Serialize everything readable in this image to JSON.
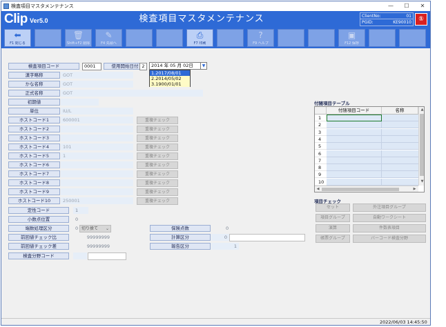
{
  "window": {
    "title": "検査項目マスタメンテナンス",
    "controls": {
      "minimize": "—",
      "maximize": "☐",
      "close": "✕"
    }
  },
  "header": {
    "logo": "Clip",
    "version": "Ver5.0",
    "title": "検査項目マスタメンテナンス",
    "client_label": "ClientNo:",
    "client_value": "01",
    "pgid_label": "PGID:",
    "pgid_value": "KE90010",
    "badge": "①"
  },
  "toolbar": [
    {
      "label": "F1 閉じる",
      "icon": "back-arrow-icon",
      "glyph": "⬅",
      "state": "active"
    },
    {
      "label": "",
      "icon": "",
      "glyph": "",
      "state": "disabled"
    },
    {
      "label": "Shift+F2 削除",
      "icon": "trash-icon",
      "glyph": "🗑",
      "state": "disabled"
    },
    {
      "label": "F4 先頭へ",
      "icon": "pencil-icon",
      "glyph": "✎",
      "state": "disabled"
    },
    {
      "label": "",
      "icon": "",
      "glyph": "",
      "state": "disabled"
    },
    {
      "label": "",
      "icon": "",
      "glyph": "",
      "state": "disabled"
    },
    {
      "label": "F7 印刷",
      "icon": "printer-icon",
      "glyph": "⎙",
      "state": "active"
    },
    {
      "label": "",
      "icon": "",
      "glyph": "",
      "state": "disabled"
    },
    {
      "label": "F9 ヘルプ",
      "icon": "help-icon",
      "glyph": "?",
      "state": "disabled"
    },
    {
      "label": "",
      "icon": "",
      "glyph": "",
      "state": "disabled"
    },
    {
      "label": "",
      "icon": "",
      "glyph": "",
      "state": "disabled"
    },
    {
      "label": "F12 保存",
      "icon": "save-icon",
      "glyph": "▣",
      "state": "disabled"
    },
    {
      "label": "",
      "icon": "",
      "glyph": "",
      "state": "disabled"
    },
    {
      "label": "",
      "icon": "",
      "glyph": "",
      "state": "disabled"
    }
  ],
  "form": {
    "code_label": "検査項目コード",
    "code_value": "0001",
    "start_date_label": "使用開始日付",
    "start_seq": "2",
    "start_date_value": "2014 年 05 月 02日",
    "date_options": [
      "1.2017/08/01",
      "2.2014/05/02",
      "3.1900/01/01"
    ],
    "kanji_label": "漢字略称",
    "kanji_value": "GOT",
    "kana_label": "かな名称",
    "kana_value": "GOT",
    "formal_label": "正式名称",
    "formal_value": "GOT",
    "initial_label": "初期値",
    "initial_value": "",
    "unit_label": "単位",
    "unit_value": "IU/L",
    "hosts": [
      {
        "label": "ホストコード1",
        "value": "600001"
      },
      {
        "label": "ホストコード2",
        "value": ""
      },
      {
        "label": "ホストコード3",
        "value": ""
      },
      {
        "label": "ホストコード4",
        "value": "101"
      },
      {
        "label": "ホストコード5",
        "value": "1"
      },
      {
        "label": "ホストコード6",
        "value": ""
      },
      {
        "label": "ホストコード7",
        "value": ""
      },
      {
        "label": "ホストコード8",
        "value": ""
      },
      {
        "label": "ホストコード9",
        "value": ""
      },
      {
        "label": "ホストコード10",
        "value": "250001"
      }
    ],
    "dup_check_label": "重複チェック",
    "fixed_code_label": "定性コード",
    "fixed_code_value": "1",
    "decimal_label": "小数点位置",
    "decimal_value": "0",
    "rounding_label": "端数処理区分",
    "rounding_value": "0",
    "rounding_option": "切り捨て",
    "prev_ratio_label": "前回値チェック比",
    "prev_ratio_value": "99999999",
    "prev_diff_label": "前回値チェック差",
    "prev_diff_value": "99999999",
    "category_label": "検査分野コード",
    "category_value": "",
    "insurance_label": "保険点数",
    "insurance_value": "0",
    "calc_label": "計算区分",
    "calc_value": "0",
    "report_label": "報告区分",
    "report_value": "1"
  },
  "side_table": {
    "title": "付随項目テーブル",
    "columns": [
      "付随項目コード",
      "名称"
    ],
    "rows": [
      "1",
      "2",
      "3",
      "4",
      "5",
      "6",
      "7",
      "8",
      "9",
      "10"
    ]
  },
  "item_check": {
    "title": "項目チェック",
    "buttons": [
      "セット",
      "外注項目グループ",
      "項目グループ",
      "自動ワークシート",
      "演算",
      "件数表項目",
      "帳票グループ",
      "バーコード検査分野"
    ]
  },
  "status": {
    "datetime": "2022/06/03  14:45:50"
  }
}
